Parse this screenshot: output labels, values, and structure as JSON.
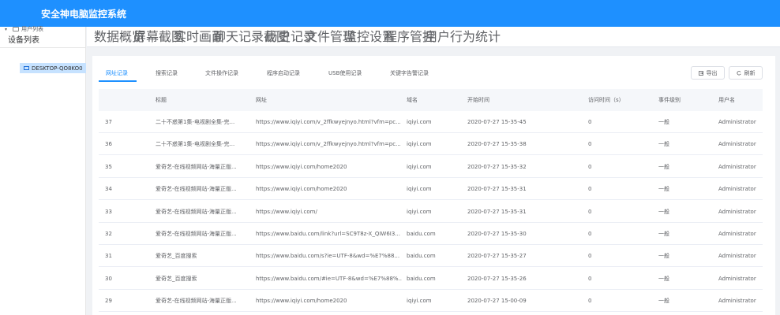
{
  "app": {
    "title": "安全神电脑监控系统"
  },
  "sidebar": {
    "title": "设备列表",
    "tree": {
      "root": "用户列表",
      "device": "DESKTOP-QO8KO0"
    }
  },
  "topnav": {
    "items": [
      "数据概览",
      "屏幕截图",
      "实时画面",
      "聊天记录截图",
      "历史记录",
      "文件管理",
      "监控设置",
      "程序管控",
      "用户行为统计"
    ],
    "active_index": 4
  },
  "subtabs": {
    "items": [
      "网址记录",
      "搜索记录",
      "文件操作记录",
      "程序启动记录",
      "USB使用记录",
      "关键字告警记录"
    ],
    "active_index": 0
  },
  "actions": {
    "export": "导出",
    "refresh": "刷新"
  },
  "table": {
    "columns": [
      "",
      "标题",
      "网址",
      "域名",
      "开始时间",
      "访问时间（s）",
      "事件级别",
      "用户名"
    ],
    "rows": [
      [
        "37",
        "二十不惑第1集-电视剧全集-完...",
        "https://www.iqiyi.com/v_2ffkwyejnyo.html?vfm=pc...",
        "iqiyi.com",
        "2020-07-27 15-35-45",
        "0",
        "一般",
        "Administrator"
      ],
      [
        "36",
        "二十不惑第1集-电视剧全集-完...",
        "https://www.iqiyi.com/v_2ffkwyejnyo.html?vfm=pc...",
        "iqiyi.com",
        "2020-07-27 15-35-38",
        "0",
        "一般",
        "Administrator"
      ],
      [
        "35",
        "爱奇艺-在线视频网站-海量正版...",
        "https://www.iqiyi.com/home2020",
        "iqiyi.com",
        "2020-07-27 15-35-32",
        "0",
        "一般",
        "Administrator"
      ],
      [
        "34",
        "爱奇艺-在线视频网站-海量正版...",
        "https://www.iqiyi.com/home2020",
        "iqiyi.com",
        "2020-07-27 15-35-31",
        "0",
        "一般",
        "Administrator"
      ],
      [
        "33",
        "爱奇艺-在线视频网站-海量正版...",
        "https://www.iqiyi.com/",
        "iqiyi.com",
        "2020-07-27 15-35-31",
        "0",
        "一般",
        "Administrator"
      ],
      [
        "32",
        "爱奇艺-在线视频网站-海量正版...",
        "https://www.baidu.com/link?url=SC9T8z-X_QIW6I3...",
        "baidu.com",
        "2020-07-27 15-35-30",
        "0",
        "一般",
        "Administrator"
      ],
      [
        "31",
        "爱奇艺_百度搜索",
        "https://www.baidu.com/s?ie=UTF-8&wd=%E7%88...",
        "baidu.com",
        "2020-07-27 15-35-27",
        "0",
        "一般",
        "Administrator"
      ],
      [
        "30",
        "爱奇艺_百度搜索",
        "https://www.baidu.com/#ie=UTF-8&wd=%E7%88%...",
        "baidu.com",
        "2020-07-27 15-35-26",
        "0",
        "一般",
        "Administrator"
      ],
      [
        "29",
        "爱奇艺-在线视频网站-海量正版...",
        "https://www.iqiyi.com/home2020",
        "iqiyi.com",
        "2020-07-27 15-00-09",
        "0",
        "一般",
        "Administrator"
      ]
    ]
  }
}
